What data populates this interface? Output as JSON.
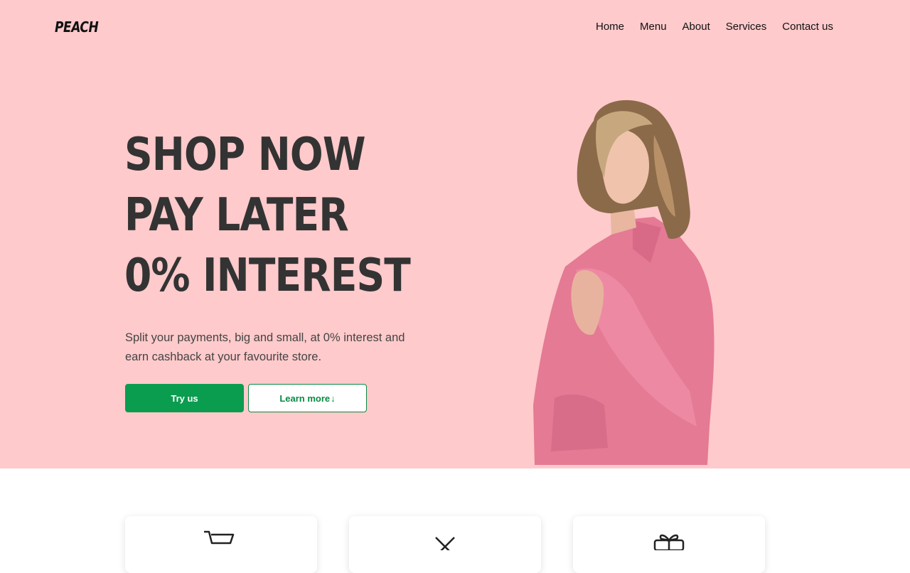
{
  "brand": {
    "logo": "PEACH"
  },
  "nav": {
    "items": [
      "Home",
      "Menu",
      "About",
      "Services",
      "Contact us"
    ]
  },
  "hero": {
    "headline": [
      "SHOP NOW",
      "PAY LATER",
      "0% INTEREST"
    ],
    "subtext": "Split your payments, big and small, at 0% interest and earn cashback at your favourite store.",
    "primary_button": "Try us",
    "secondary_button": "Learn more",
    "secondary_button_arrow": "↓"
  },
  "colors": {
    "hero_background": "#fecacb",
    "primary": "#0a9c4f",
    "headline": "#333333"
  },
  "features": {
    "cards": [
      {
        "icon": "shopping-cart-icon"
      },
      {
        "icon": "close-x-icon"
      },
      {
        "icon": "gift-icon"
      }
    ]
  }
}
